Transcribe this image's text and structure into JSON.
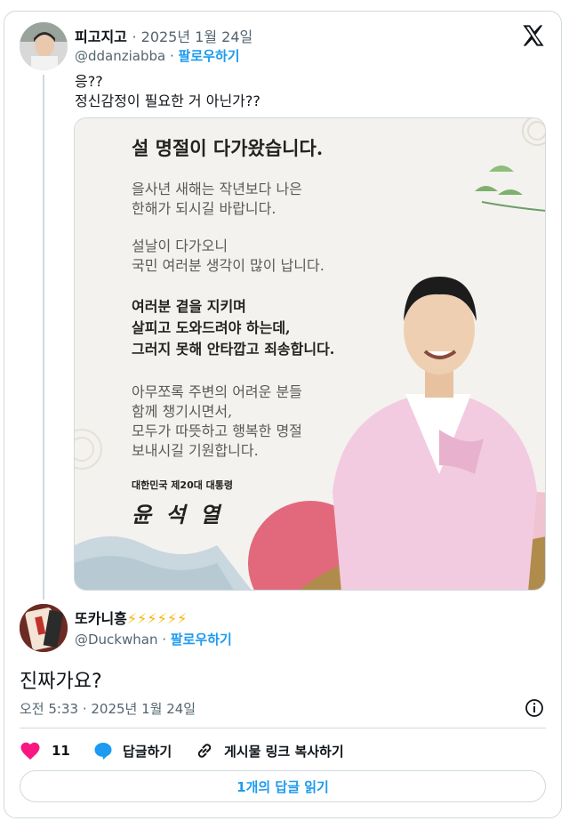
{
  "quoted": {
    "display_name": "피고지고",
    "date": "· 2025년 1월 24일",
    "handle": "@ddanziabba",
    "follow_label": "팔로우하기",
    "text_lines": [
      "응??",
      "정신감정이 필요한 거 아닌가??"
    ]
  },
  "greeting_card": {
    "title": "설 명절이 다가왔습니다.",
    "paragraph1": [
      "을사년 새해는 작년보다 나은",
      "한해가 되시길 바랍니다."
    ],
    "paragraph2": [
      "설날이 다가오니",
      "국민 여러분 생각이 많이 납니다."
    ],
    "paragraph3": [
      "여러분 곁을 지키며",
      "살피고 도와드려야 하는데,",
      "그러지 못해 안타깝고 죄송합니다."
    ],
    "paragraph4": [
      "아무쪼록 주변의 어려운 분들",
      "함께 챙기시면서,",
      "모두가 따뜻하고 행복한 명절",
      "보내시길 기원합니다."
    ],
    "sign_title": "대한민국 제20대 대통령",
    "signature": "윤 석 열"
  },
  "reply": {
    "display_name": "또카니흥",
    "name_emoji": "⚡⚡⚡⚡⚡⚡",
    "handle": "@Duckwhan",
    "follow_label": "팔로우하기",
    "text": "진짜가요?",
    "timestamp": "오전 5:33 · 2025년 1월 24일"
  },
  "actions": {
    "like_count": "11",
    "reply_label": "답글하기",
    "copy_link_label": "게시물 링크 복사하기",
    "read_replies_label": "1개의 답글 읽기"
  },
  "colors": {
    "accent": "#1d9bf0",
    "like": "#f91880",
    "border": "#cfd9de",
    "muted": "#536471"
  }
}
